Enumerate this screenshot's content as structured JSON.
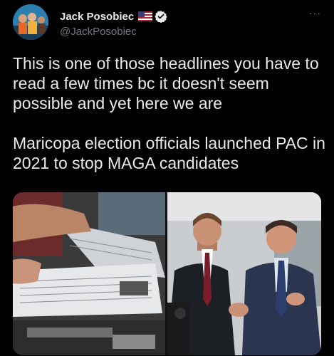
{
  "author": {
    "display_name": "Jack Posobiec",
    "handle": "@JackPosobiec",
    "flag_icon": "us-flag-icon",
    "verified_icon": "verified-badge-icon"
  },
  "more_label": "···",
  "tweet": {
    "paragraphs": [
      "This is one of those headlines you have to read a few times bc it doesn't seem possible and yet here we are",
      "Maricopa election officials launched PAC in 2021 to stop MAGA candidates"
    ]
  },
  "colors": {
    "background": "#000000",
    "text": "#e7e9ea",
    "secondary": "#71767b",
    "verified": "#e7e9ea"
  }
}
